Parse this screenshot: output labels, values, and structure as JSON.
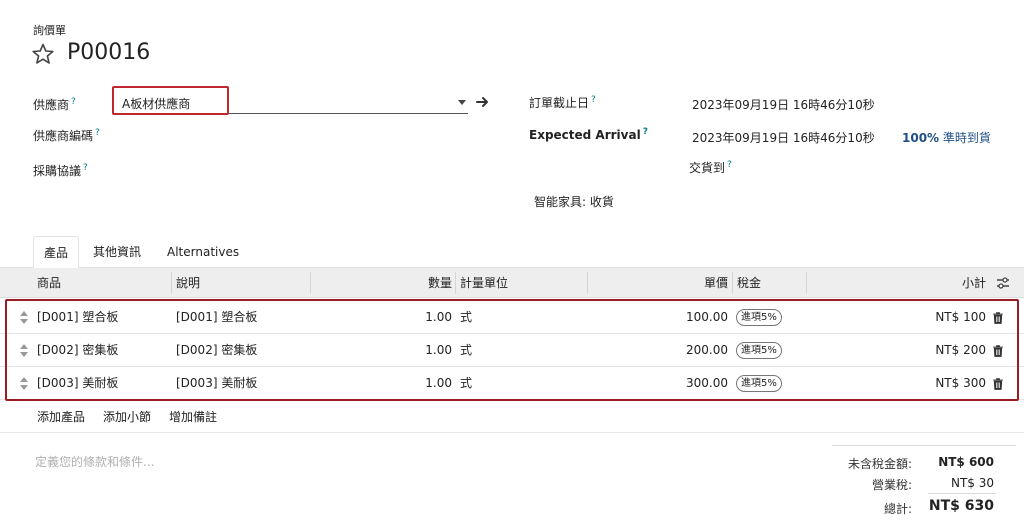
{
  "header": {
    "doc_type": "詢價單",
    "doc_number": "P00016"
  },
  "fields": {
    "vendor_label": "供應商",
    "vendor_value": "A板材供應商",
    "vendor_ref_label": "供應商編碼",
    "agreement_label": "採購協議",
    "deadline_label": "訂單截止日",
    "deadline_value": "2023年09月19日 16時46分10秒",
    "arrival_label": "Expected Arrival",
    "arrival_value": "2023年09月19日 16時46分10秒",
    "ontime_pct": "100%",
    "ontime_text": "準時到貨",
    "deliver_to_label": "交貨到",
    "deliver_to_value": "智能家具: 收貨",
    "help_mark": "?"
  },
  "tabs": [
    {
      "label": "產品",
      "active": true
    },
    {
      "label": "其他資訊",
      "active": false
    },
    {
      "label": "Alternatives",
      "active": false
    }
  ],
  "table": {
    "columns": [
      "商品",
      "說明",
      "數量",
      "計量單位",
      "單價",
      "稅金",
      "小計"
    ],
    "rows": [
      {
        "product": "[D001] 塑合板",
        "description": "[D001] 塑合板",
        "qty": "1.00",
        "uom": "式",
        "price": "100.00",
        "tax": "進項5%",
        "subtotal": "NT$ 100"
      },
      {
        "product": "[D002] 密集板",
        "description": "[D002] 密集板",
        "qty": "1.00",
        "uom": "式",
        "price": "200.00",
        "tax": "進項5%",
        "subtotal": "NT$ 200"
      },
      {
        "product": "[D003] 美耐板",
        "description": "[D003] 美耐板",
        "qty": "1.00",
        "uom": "式",
        "price": "300.00",
        "tax": "進項5%",
        "subtotal": "NT$ 300"
      }
    ]
  },
  "actions": {
    "add_product": "添加產品",
    "add_section": "添加小節",
    "add_note": "增加備註"
  },
  "terms_placeholder": "定義您的條款和條件...",
  "totals": {
    "untaxed_label": "未含稅金額:",
    "untaxed_value": "NT$ 600",
    "tax_label": "營業稅:",
    "tax_value": "NT$ 30",
    "total_label": "總計:",
    "total_value": "NT$ 630"
  },
  "colors": {
    "highlight": "#c0272d",
    "help": "#017e84"
  }
}
